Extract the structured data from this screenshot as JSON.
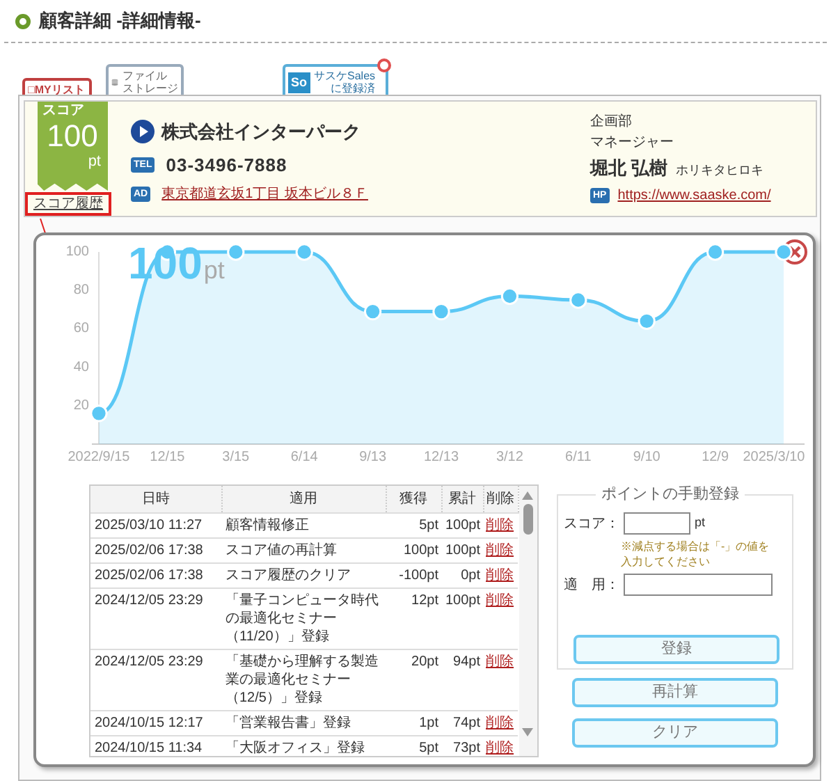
{
  "header": {
    "title": "顧客詳細 -詳細情報-"
  },
  "tabs": [
    {
      "kind": "mylist",
      "lines": [
        "□MYリスト"
      ]
    },
    {
      "kind": "storage",
      "lines": [
        "ファイル",
        "ストレージ"
      ]
    },
    {
      "kind": "sales",
      "icon_text": "So",
      "lines": [
        "サスケSales",
        "に登録済"
      ]
    }
  ],
  "score": {
    "label": "スコア",
    "value": "100",
    "unit": "pt",
    "history_link": "スコア履歴"
  },
  "company": {
    "name": "株式会社インターパーク",
    "tel_icon": "TEL",
    "tel": "03-3496-7888",
    "address_icon": "AD",
    "address": "東京都道玄坂1丁目 坂本ビル８Ｆ"
  },
  "contact": {
    "department": "企画部",
    "position": "マネージャー",
    "name": "堀北 弘樹",
    "kana": "ホリキタヒロキ",
    "url_icon": "HP",
    "url": "https://www.saaske.com/"
  },
  "popup": {
    "big_value": "100",
    "big_unit": "pt",
    "chart_data": {
      "type": "area",
      "categories": [
        "2022/9/15",
        "12/15",
        "3/15",
        "6/14",
        "9/13",
        "12/13",
        "3/12",
        "6/11",
        "9/10",
        "12/9",
        "2025/3/10"
      ],
      "series": [
        {
          "color": "#5bc8f5",
          "values": [
            16,
            100,
            100,
            100,
            69,
            69,
            77,
            75,
            64,
            100,
            100
          ]
        }
      ],
      "ylim": [
        0,
        100
      ],
      "yticks": [
        20,
        40,
        60,
        80,
        100
      ]
    },
    "table": {
      "columns": [
        "日時",
        "適用",
        "獲得",
        "累計",
        "削除"
      ],
      "rows": [
        [
          "2025/03/10 11:27",
          "顧客情報修正",
          "5pt",
          "100pt",
          "削除"
        ],
        [
          "2025/02/06 17:38",
          "スコア値の再計算",
          "100pt",
          "100pt",
          "削除"
        ],
        [
          "2025/02/06 17:38",
          "スコア履歴のクリア",
          "-100pt",
          "0pt",
          "削除"
        ],
        [
          "2024/12/05 23:29",
          "「量子コンピュータ時代の最適化セミナー（11/20）」登録",
          "12pt",
          "100pt",
          "削除"
        ],
        [
          "2024/12/05 23:29",
          "「基礎から理解する製造業の最適化セミナー（12/5）」登録",
          "20pt",
          "94pt",
          "削除"
        ],
        [
          "2024/10/15 12:17",
          "「営業報告書」登録",
          "1pt",
          "74pt",
          "削除"
        ],
        [
          "2024/10/15 11:34",
          "「大阪オフィス」登録",
          "5pt",
          "73pt",
          "削除"
        ]
      ]
    },
    "manual_entry": {
      "legend": "ポイントの手動登録",
      "score_label": "スコア：",
      "unit": "pt",
      "note": "※減点する場合は「-」の値を入力してください",
      "apply_label": "適　用：",
      "register_button": "登録"
    },
    "buttons": [
      "再計算",
      "クリア"
    ]
  }
}
